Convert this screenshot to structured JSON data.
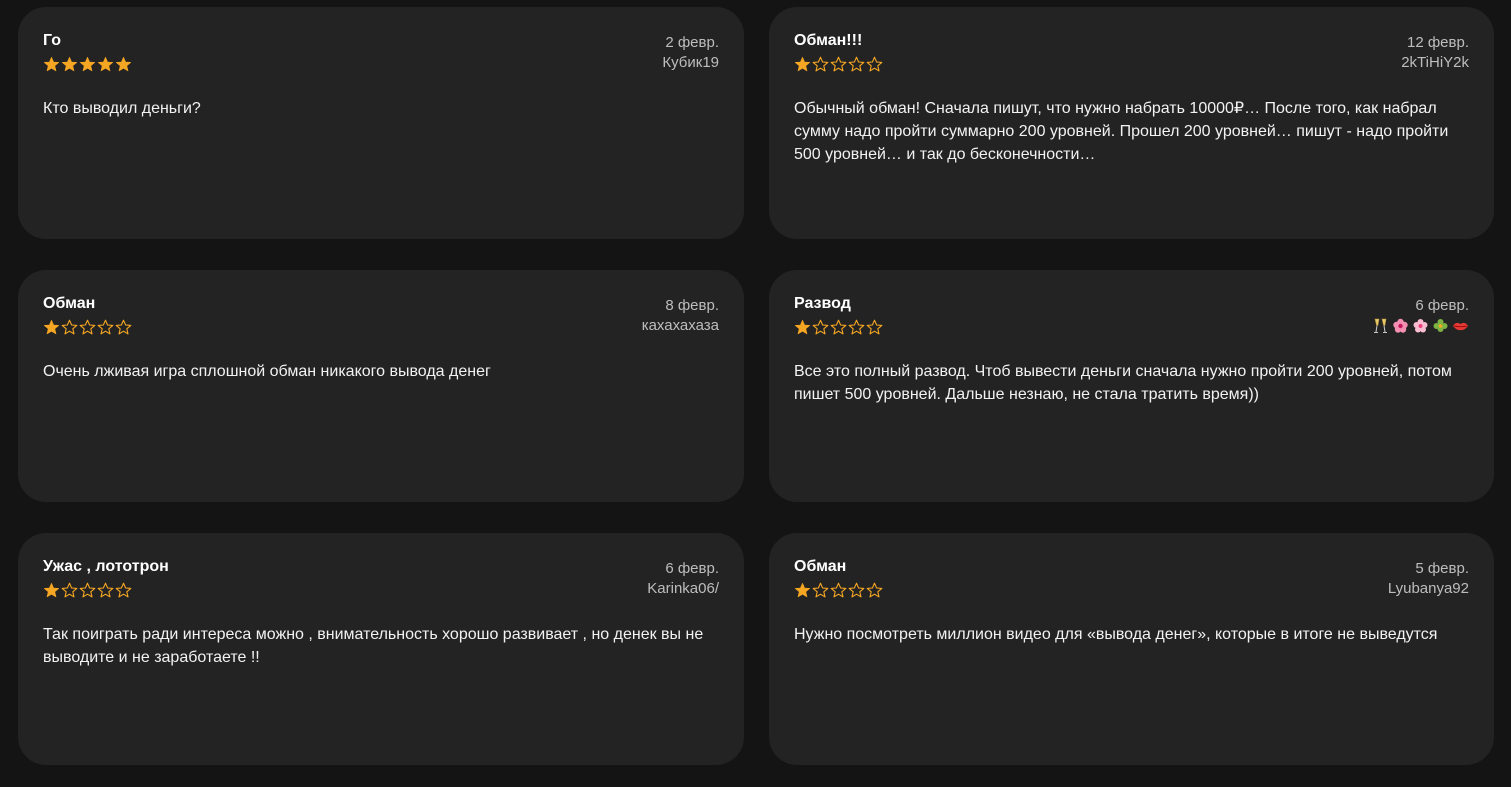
{
  "colors": {
    "background": "#141414",
    "card": "#232323",
    "star_filled": "#f5a623",
    "star_empty_outline": "#f5a623",
    "meta_text": "#bdbdbd"
  },
  "reviews": [
    {
      "title": "Го",
      "date": "2 февр.",
      "author": "Кубик19",
      "rating": 5,
      "text": "Кто выводил деньги?"
    },
    {
      "title": "Обман!!!",
      "date": "12 февр.",
      "author": "2kTiHiY2k",
      "rating": 1,
      "text": "Обычный обман! Сначала пишут, что нужно набрать 10000₽… После того, как набрал сумму надо пройти суммарно 200 уровней. Прошел 200 уровней… пишут - надо пройти 500 уровней… и так до бесконечности…"
    },
    {
      "title": "Обман",
      "date": "8 февр.",
      "author": "кахахахаза",
      "rating": 1,
      "text": "Очень лживая игра сплошной обман никакого вывода денег"
    },
    {
      "title": "Развод",
      "date": "6 февр.",
      "author": "",
      "author_emoji": [
        "champagne-glasses-icon",
        "flower-icon",
        "flower-icon",
        "clover-icon",
        "lips-icon"
      ],
      "rating": 1,
      "text": "Все это полный развод. Чтоб вывести деньги сначала нужно пройти 200 уровней, потом пишет 500 уровней. Дальше незнаю, не стала тратить время))"
    },
    {
      "title": "Ужас , лототрон",
      "date": "6 февр.",
      "author": "Karinka06/",
      "rating": 1,
      "text": "Так поиграть ради интереса можно , внимательность хорошо развивает , но денек вы не выводите и не заработаете !!"
    },
    {
      "title": "Обман",
      "date": "5 февр.",
      "author": "Lyubanya92",
      "rating": 1,
      "text": "Нужно посмотреть миллион видео для «вывода денег», которые в итоге не выведутся"
    }
  ]
}
